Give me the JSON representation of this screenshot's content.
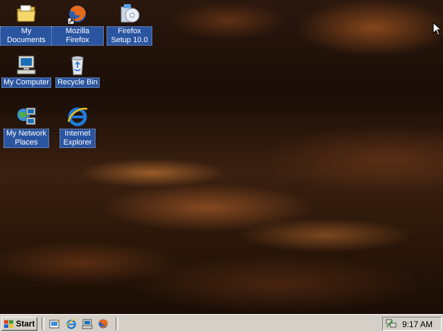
{
  "desktop": {
    "icons": [
      {
        "label": "My Documents",
        "icon": "folder-documents-icon"
      },
      {
        "label": "Mozilla Firefox",
        "icon": "firefox-icon"
      },
      {
        "label": "Firefox Setup 10.0",
        "icon": "installer-cd-icon"
      },
      {
        "label": "My Computer",
        "icon": "computer-icon"
      },
      {
        "label": "Recycle Bin",
        "icon": "recycle-bin-icon"
      },
      {
        "label": "My Network Places",
        "icon": "network-places-icon"
      },
      {
        "label": "Internet Explorer",
        "icon": "internet-explorer-icon"
      }
    ]
  },
  "taskbar": {
    "start_label": "Start",
    "quick_launch": [
      "show-desktop-icon",
      "internet-explorer-icon",
      "outlook-express-icon",
      "firefox-icon"
    ],
    "clock": "9:17 AM"
  },
  "colors": {
    "taskbar": "#d4d0c8",
    "icon_label_selected": "#2a55a0"
  }
}
